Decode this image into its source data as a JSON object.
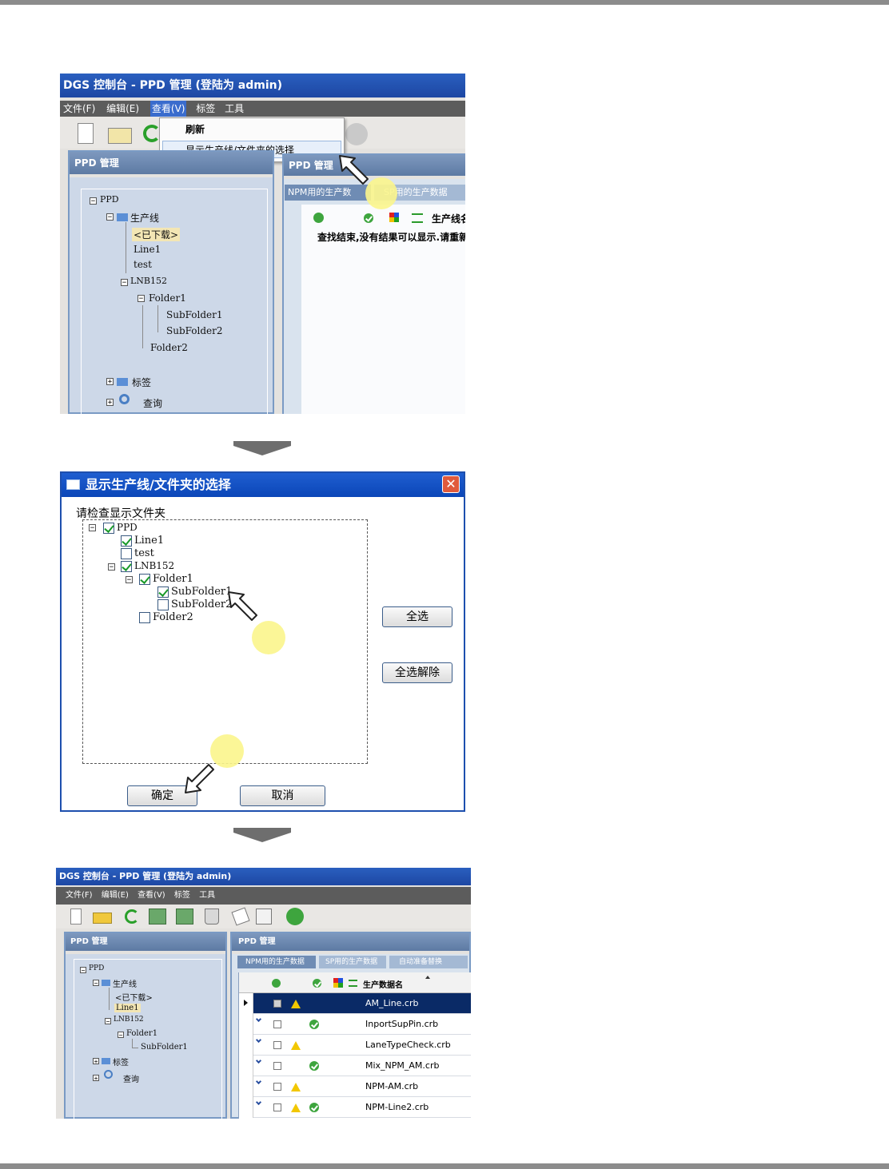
{
  "screen1": {
    "title": "DGS 控制台 - PPD 管理 (登陆为 admin)",
    "menu": [
      "文件(F)",
      "编辑(E)",
      "查看(V)",
      "标签",
      "工具"
    ],
    "dropdown": [
      "刷新",
      "显示生产线/文件夹的选择"
    ],
    "left_panel_title": "PPD 管理",
    "right_panel_title": "PPD 管理",
    "tabs": [
      "NPM用的生产数",
      "SP用的生产数据"
    ],
    "grid_header_label": "生产线名",
    "message": "查找结束,没有结果可以显示.请重新",
    "tree": {
      "root": "PPD",
      "line_group": "生产线",
      "downloaded": "<已下载>",
      "line1": "Line1",
      "test": "test",
      "lnb": "LNB152",
      "folder1": "Folder1",
      "sub1": "SubFolder1",
      "sub2": "SubFolder2",
      "folder2": "Folder2",
      "tags": "标签",
      "query": "查询"
    }
  },
  "dialog": {
    "title": "显示生产线/文件夹的选择",
    "prompt": "请检查显示文件夹",
    "items": [
      {
        "label": "PPD",
        "checked": true
      },
      {
        "label": "Line1",
        "checked": true
      },
      {
        "label": "test",
        "checked": false
      },
      {
        "label": "LNB152",
        "checked": true
      },
      {
        "label": "Folder1",
        "checked": true
      },
      {
        "label": "SubFolder1",
        "checked": true
      },
      {
        "label": "SubFolder2",
        "checked": false
      },
      {
        "label": "Folder2",
        "checked": false
      }
    ],
    "select_all": "全选",
    "deselect_all": "全选解除",
    "ok": "确定",
    "cancel": "取消"
  },
  "screen3": {
    "title": "DGS 控制台 - PPD 管理 (登陆为 admin)",
    "menu": [
      "文件(F)",
      "编辑(E)",
      "查看(V)",
      "标签",
      "工具"
    ],
    "left_panel_title": "PPD 管理",
    "right_panel_title": "PPD 管理",
    "tabs": [
      "NPM用的生产数据",
      "SP用的生产数据",
      "自动准备替换"
    ],
    "grid_columns": [
      "",
      "",
      "生产数据名"
    ],
    "tree": {
      "root": "PPD",
      "line_group": "生产线",
      "downloaded": "<已下载>",
      "line1": "Line1",
      "lnb": "LNB152",
      "folder1": "Folder1",
      "sub1": "SubFolder1",
      "tags": "标签",
      "query": "查询"
    },
    "rows": [
      {
        "name": "AM_Line.crb",
        "warn": true,
        "ok": false,
        "selected": true
      },
      {
        "name": "InportSupPin.crb",
        "warn": false,
        "ok": true,
        "selected": false
      },
      {
        "name": "LaneTypeCheck.crb",
        "warn": true,
        "ok": false,
        "selected": false
      },
      {
        "name": "Mix_NPM_AM.crb",
        "warn": false,
        "ok": true,
        "selected": false
      },
      {
        "name": "NPM-AM.crb",
        "warn": true,
        "ok": false,
        "selected": false
      },
      {
        "name": "NPM-Line2.crb",
        "warn": true,
        "ok": true,
        "selected": false
      }
    ]
  },
  "colors": {
    "titlebar": "#1d47a3",
    "panel_head": "#5d7aa3",
    "panel_body": "#cdd8e8",
    "callout": "#fbf58c",
    "selected_row": "#0a2a66"
  }
}
